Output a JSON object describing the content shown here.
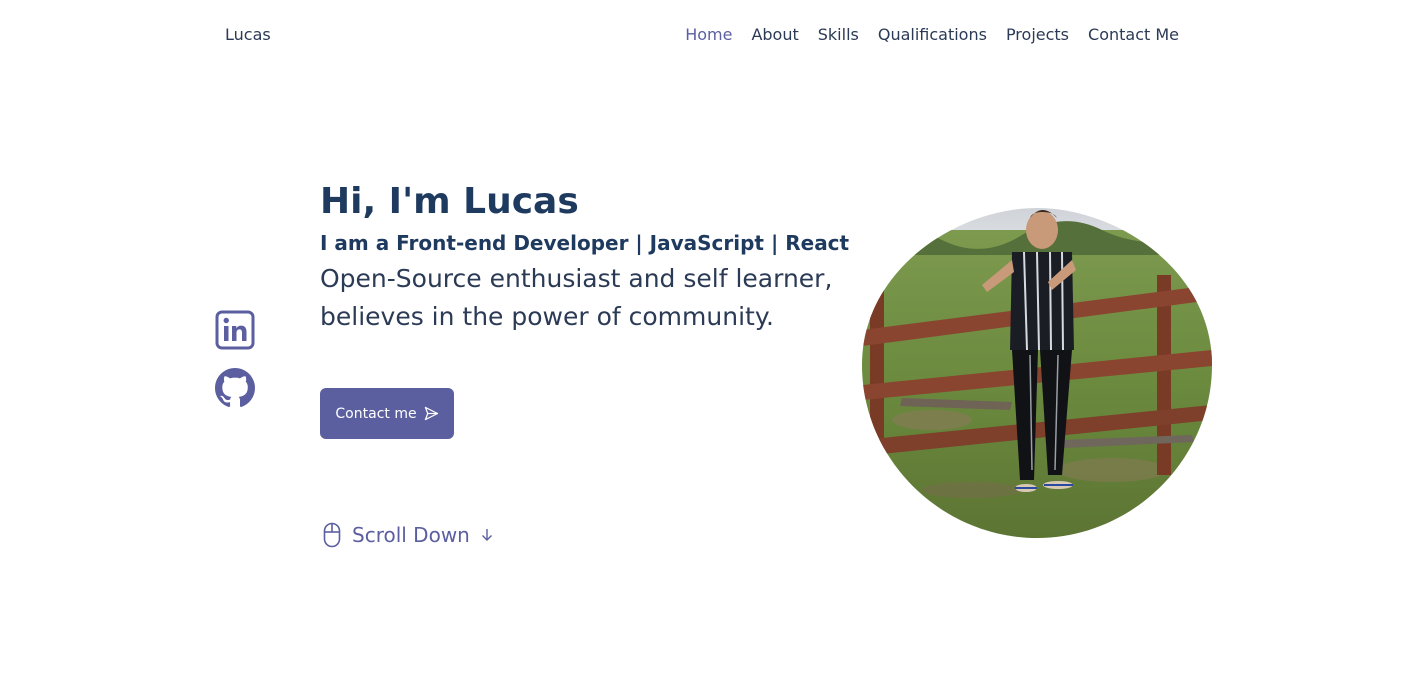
{
  "header": {
    "logo": "Lucas",
    "nav": [
      {
        "label": "Home",
        "active": true
      },
      {
        "label": "About",
        "active": false
      },
      {
        "label": "Skills",
        "active": false
      },
      {
        "label": "Qualifications",
        "active": false
      },
      {
        "label": "Projects",
        "active": false
      },
      {
        "label": "Contact Me",
        "active": false
      }
    ]
  },
  "social": {
    "icons": [
      "linkedin-icon",
      "github-icon"
    ]
  },
  "hero": {
    "title": "Hi, I'm Lucas",
    "subtitle": "I am a Front-end Developer | JavaScript | React",
    "description_line1": "Open-Source enthusiast and self learner,",
    "description_line2": "believes in the power of community.",
    "contact_button": "Contact me",
    "contact_icon": "send-icon",
    "scroll_label": "Scroll Down",
    "scroll_icons": [
      "mouse-icon",
      "arrow-down-icon"
    ],
    "photo": "profile-photo"
  },
  "colors": {
    "accent": "#5b5fa0",
    "title": "#1f3a5f",
    "text": "#2b3a55",
    "background": "#ffffff"
  }
}
